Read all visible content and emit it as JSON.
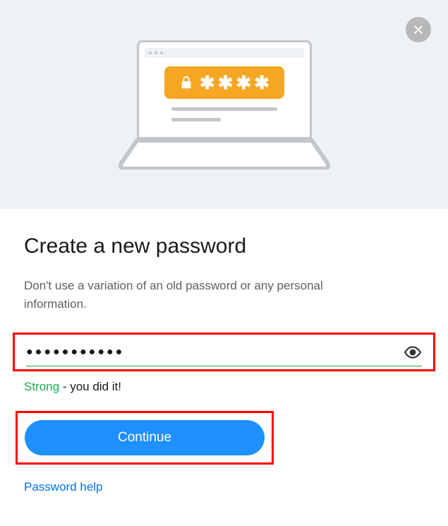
{
  "title": "Create a new password",
  "subtitle": "Don't use a variation of an old password or any personal information.",
  "password_value": "●●●●●●●●●●●",
  "strength": {
    "label": "Strong",
    "suffix": " - you did it!"
  },
  "continue_label": "Continue",
  "help_label": "Password help",
  "colors": {
    "accent": "#1e90ff",
    "success": "#1aa84a",
    "highlight": "#ff0000",
    "pill": "#f5a623"
  }
}
